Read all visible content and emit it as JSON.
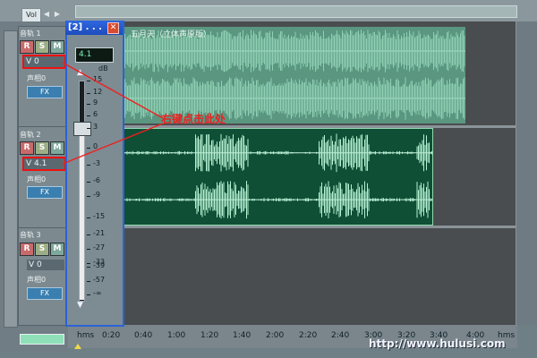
{
  "top": {
    "vol_label": "Vol",
    "left_arrow": "◀",
    "right_arrow": "▶"
  },
  "tracks": [
    {
      "name": "音轨 1",
      "r": "R",
      "s": "S",
      "m": "M",
      "volume": "V 0",
      "pan": "声相0",
      "fx": "FX",
      "number": "1"
    },
    {
      "name": "音轨 2",
      "r": "R",
      "s": "S",
      "m": "M",
      "volume": "V 4.1",
      "pan": "声相0",
      "fx": "FX",
      "number": "2"
    },
    {
      "name": "音轨 3",
      "r": "R",
      "s": "S",
      "m": "M",
      "volume": "V 0",
      "pan": "声相0",
      "fx": "FX",
      "number": "3"
    }
  ],
  "clip1": {
    "title": "五月天（立体声原版）"
  },
  "fader": {
    "title": "[2] . . .",
    "close": "✕",
    "value": "4.1",
    "unit": "dB",
    "level_db": 4.1,
    "scale": [
      "15",
      "12",
      "9",
      "6",
      "3",
      "0",
      "-3",
      "-6",
      "-9",
      "-15",
      "-21",
      "-27",
      "-33",
      "-39",
      "-57",
      "-∞"
    ],
    "up_arrow": "▲",
    "down_arrow": "▼"
  },
  "ruler": {
    "ticks": [
      "hms",
      "0:20",
      "0:40",
      "1:00",
      "1:20",
      "1:40",
      "2:00",
      "2:20",
      "2:40",
      "3:00",
      "3:20",
      "3:40",
      "4:00",
      "hms"
    ]
  },
  "annotation": {
    "text": "右键点击此处"
  },
  "watermark": {
    "text": "http://www.hulusi.com"
  },
  "colors": {
    "clip1": "#5a9680",
    "clip2": "#0f4f36",
    "waveform": "#9fe6c4",
    "annotation": "#ee2020",
    "fader_border": "#2a63d6"
  }
}
